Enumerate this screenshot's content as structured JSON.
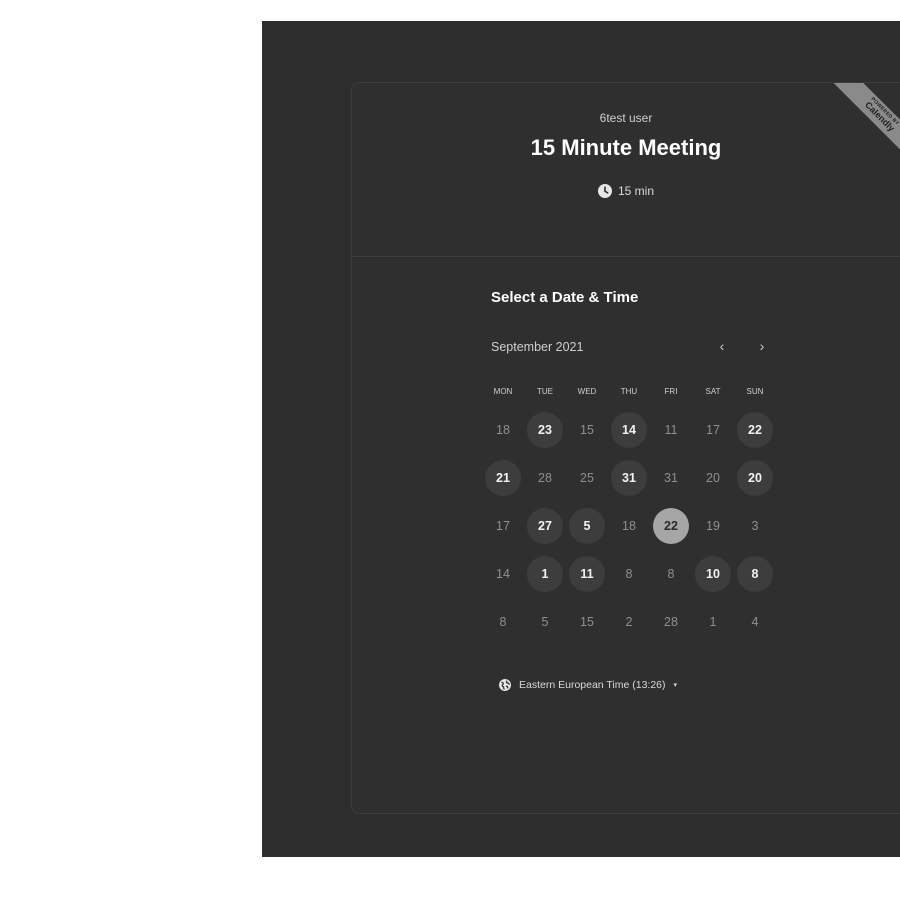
{
  "header": {
    "organizer": "6test user",
    "event_title": "15 Minute Meeting",
    "duration": "15 min",
    "ribbon_top": "POWERED BY",
    "ribbon_brand": "Calendly"
  },
  "calendar": {
    "section_title": "Select a Date & Time",
    "month_label": "September 2021",
    "prev_label": "‹",
    "next_label": "›",
    "weekdays": [
      "MON",
      "TUE",
      "WED",
      "THU",
      "FRI",
      "SAT",
      "SUN"
    ],
    "weeks": [
      [
        {
          "label": "18",
          "state": "disabled"
        },
        {
          "label": "23",
          "state": "available"
        },
        {
          "label": "15",
          "state": "disabled"
        },
        {
          "label": "14",
          "state": "available"
        },
        {
          "label": "11",
          "state": "disabled"
        },
        {
          "label": "17",
          "state": "disabled"
        },
        {
          "label": "22",
          "state": "available"
        }
      ],
      [
        {
          "label": "21",
          "state": "available"
        },
        {
          "label": "28",
          "state": "disabled"
        },
        {
          "label": "25",
          "state": "disabled"
        },
        {
          "label": "31",
          "state": "available"
        },
        {
          "label": "31",
          "state": "disabled"
        },
        {
          "label": "20",
          "state": "disabled"
        },
        {
          "label": "20",
          "state": "available"
        }
      ],
      [
        {
          "label": "17",
          "state": "disabled"
        },
        {
          "label": "27",
          "state": "available"
        },
        {
          "label": "5",
          "state": "available"
        },
        {
          "label": "18",
          "state": "disabled"
        },
        {
          "label": "22",
          "state": "selected"
        },
        {
          "label": "19",
          "state": "disabled"
        },
        {
          "label": "3",
          "state": "disabled"
        }
      ],
      [
        {
          "label": "14",
          "state": "disabled"
        },
        {
          "label": "1",
          "state": "available"
        },
        {
          "label": "11",
          "state": "available"
        },
        {
          "label": "8",
          "state": "disabled"
        },
        {
          "label": "8",
          "state": "disabled"
        },
        {
          "label": "10",
          "state": "available"
        },
        {
          "label": "8",
          "state": "available"
        }
      ],
      [
        {
          "label": "8",
          "state": "disabled"
        },
        {
          "label": "5",
          "state": "disabled"
        },
        {
          "label": "15",
          "state": "disabled"
        },
        {
          "label": "2",
          "state": "disabled"
        },
        {
          "label": "28",
          "state": "disabled"
        },
        {
          "label": "1",
          "state": "disabled"
        },
        {
          "label": "4",
          "state": "disabled"
        }
      ]
    ]
  },
  "timezone": {
    "label": "Eastern European Time (13:26)",
    "icon": "globe-icon",
    "caret": "▾"
  },
  "icons": {
    "duration_icon": "clock-icon",
    "prev_icon": "chevron-left-icon",
    "next_icon": "chevron-right-icon"
  },
  "colors": {
    "page_background": "#2d2d2d",
    "card_background": "#2f2f2f",
    "available_day": "#3d3d3d",
    "selected_day": "#a6a6a6",
    "ribbon": "#8a8a8a"
  }
}
